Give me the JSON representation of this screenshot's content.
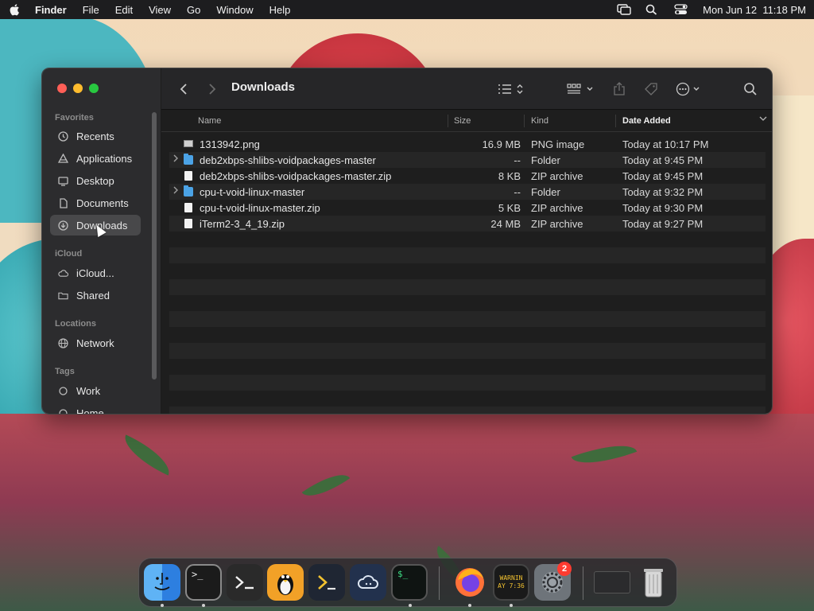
{
  "menubar": {
    "app_name": "Finder",
    "menus": [
      "File",
      "Edit",
      "View",
      "Go",
      "Window",
      "Help"
    ],
    "clock": "Mon Jun 12  11:18 PM"
  },
  "finder": {
    "title": "Downloads",
    "sidebar": {
      "favorites_label": "Favorites",
      "favorites": [
        {
          "label": "Recents",
          "icon": "clock-icon"
        },
        {
          "label": "Applications",
          "icon": "applications-icon"
        },
        {
          "label": "Desktop",
          "icon": "desktop-icon"
        },
        {
          "label": "Documents",
          "icon": "document-icon"
        },
        {
          "label": "Downloads",
          "icon": "download-icon",
          "selected": true
        }
      ],
      "icloud_label": "iCloud",
      "icloud": [
        {
          "label": "iCloud...",
          "icon": "cloud-icon"
        },
        {
          "label": "Shared",
          "icon": "shared-folder-icon"
        }
      ],
      "locations_label": "Locations",
      "locations": [
        {
          "label": "Network",
          "icon": "globe-icon"
        }
      ],
      "tags_label": "Tags",
      "tags": [
        {
          "label": "Work",
          "icon": "tag-circle-icon"
        },
        {
          "label": "Home",
          "icon": "tag-circle-icon"
        }
      ]
    },
    "columns": {
      "name": "Name",
      "size": "Size",
      "kind": "Kind",
      "date_added": "Date Added"
    },
    "files": [
      {
        "name": "1313942.png",
        "size": "16.9 MB",
        "kind": "PNG image",
        "date_added": "Today at 10:17 PM",
        "type": "image",
        "expandable": false
      },
      {
        "name": "deb2xbps-shlibs-voidpackages-master",
        "size": "--",
        "kind": "Folder",
        "date_added": "Today at 9:45 PM",
        "type": "folder",
        "expandable": true
      },
      {
        "name": "deb2xbps-shlibs-voidpackages-master.zip",
        "size": "8 KB",
        "kind": "ZIP archive",
        "date_added": "Today at 9:45 PM",
        "type": "file",
        "expandable": false
      },
      {
        "name": "cpu-t-void-linux-master",
        "size": "--",
        "kind": "Folder",
        "date_added": "Today at 9:32 PM",
        "type": "folder",
        "expandable": true
      },
      {
        "name": "cpu-t-void-linux-master.zip",
        "size": "5 KB",
        "kind": "ZIP archive",
        "date_added": "Today at 9:30 PM",
        "type": "file",
        "expandable": false
      },
      {
        "name": "iTerm2-3_4_19.zip",
        "size": "24 MB",
        "kind": "ZIP archive",
        "date_added": "Today at 9:27 PM",
        "type": "file",
        "expandable": false
      }
    ]
  },
  "dock": {
    "apps": [
      "Finder",
      "Terminal",
      "iTerm",
      "Linux",
      "PowerShell",
      "Cloud",
      "Terminal Dark",
      "Firefox",
      "Console",
      "System Settings"
    ],
    "console_lines": [
      "WARNIN",
      "AY 7:36"
    ],
    "terminal_prompt": ">_",
    "terminal_dark_prompt": "$_",
    "settings_badge": "2"
  }
}
